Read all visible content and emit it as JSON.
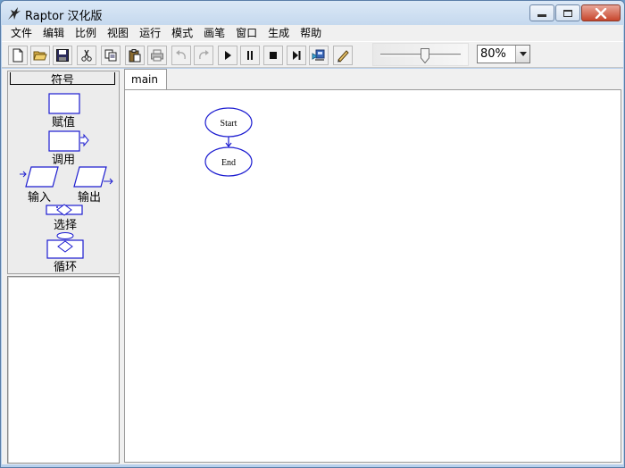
{
  "window": {
    "title": "Raptor 汉化版"
  },
  "menu": [
    "文件",
    "编辑",
    "比例",
    "视图",
    "运行",
    "模式",
    "画笔",
    "窗口",
    "生成",
    "帮助"
  ],
  "toolbar": {
    "buttons": [
      {
        "name": "new-button",
        "icon": "new-file-icon",
        "enabled": true
      },
      {
        "name": "open-button",
        "icon": "open-folder-icon",
        "enabled": true
      },
      {
        "name": "save-button",
        "icon": "floppy-disk-icon",
        "enabled": true
      },
      {
        "name": "cut-button",
        "icon": "scissors-icon",
        "enabled": true
      },
      {
        "name": "copy-button",
        "icon": "copy-icon",
        "enabled": true
      },
      {
        "name": "paste-button",
        "icon": "clipboard-icon",
        "enabled": true
      },
      {
        "name": "print-button",
        "icon": "printer-icon",
        "enabled": false
      },
      {
        "name": "undo-button",
        "icon": "undo-icon",
        "enabled": false
      },
      {
        "name": "redo-button",
        "icon": "redo-icon",
        "enabled": false
      },
      {
        "name": "run-button",
        "icon": "play-icon",
        "enabled": true
      },
      {
        "name": "pause-button",
        "icon": "pause-icon",
        "enabled": true
      },
      {
        "name": "stop-button",
        "icon": "stop-icon",
        "enabled": true
      },
      {
        "name": "step-button",
        "icon": "step-icon",
        "enabled": true
      },
      {
        "name": "generate-button",
        "icon": "network-drive-icon",
        "enabled": true
      },
      {
        "name": "pen-button",
        "icon": "pencil-icon",
        "enabled": true
      }
    ],
    "speed_slider": 0.55,
    "zoom": "80%"
  },
  "symbols": {
    "title": "符号",
    "assign": "赋值",
    "call": "调用",
    "input": "输入",
    "output": "输出",
    "selection": "选择",
    "loop": "循环"
  },
  "tabs": [
    {
      "label": "main"
    }
  ],
  "flowchart": {
    "start": "Start",
    "end": "End",
    "stroke": "#1c1cd0"
  }
}
